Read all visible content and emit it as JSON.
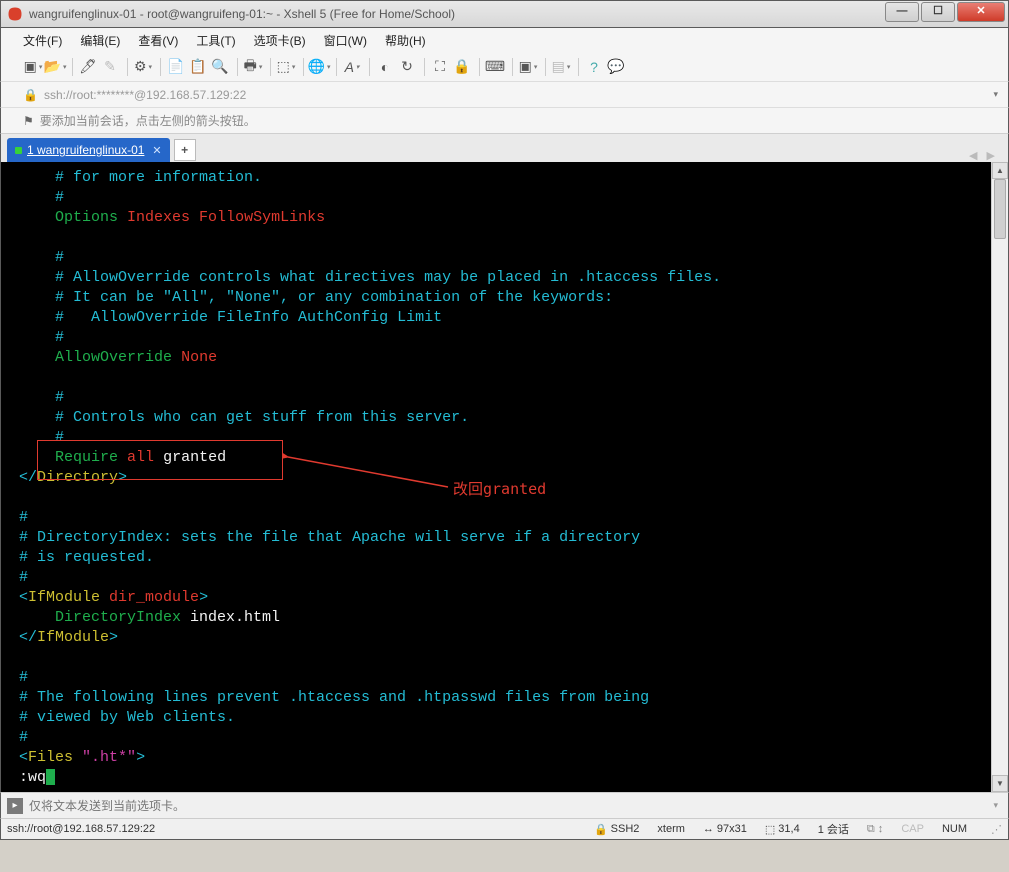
{
  "title": "wangruifenglinux-01 - root@wangruifeng-01:~ - Xshell 5 (Free for Home/School)",
  "menu": {
    "file": "文件(F)",
    "edit": "编辑(E)",
    "view": "查看(V)",
    "tools": "工具(T)",
    "tabs": "选项卡(B)",
    "window": "窗口(W)",
    "help": "帮助(H)"
  },
  "address": "ssh://root:********@192.168.57.129:22",
  "hint": "要添加当前会话，点击左侧的箭头按钮。",
  "tab_name": "1 wangruifenglinux-01",
  "annotation_label": "改回granted",
  "terminal_lines": [
    {
      "indent": 4,
      "parts": [
        {
          "c": "cyan",
          "t": "# for more information."
        }
      ]
    },
    {
      "indent": 4,
      "parts": [
        {
          "c": "cyan",
          "t": "#"
        }
      ]
    },
    {
      "indent": 4,
      "parts": [
        {
          "c": "grn",
          "t": "Options"
        },
        {
          "c": "wht",
          "t": " "
        },
        {
          "c": "red",
          "t": "Indexes FollowSymLinks"
        }
      ]
    },
    {
      "indent": 4,
      "parts": []
    },
    {
      "indent": 4,
      "parts": [
        {
          "c": "cyan",
          "t": "#"
        }
      ]
    },
    {
      "indent": 4,
      "parts": [
        {
          "c": "cyan",
          "t": "# AllowOverride controls what directives may be placed in .htaccess files."
        }
      ]
    },
    {
      "indent": 4,
      "parts": [
        {
          "c": "cyan",
          "t": "# It can be \"All\", \"None\", or any combination of the keywords:"
        }
      ]
    },
    {
      "indent": 4,
      "parts": [
        {
          "c": "cyan",
          "t": "#   AllowOverride FileInfo AuthConfig Limit"
        }
      ]
    },
    {
      "indent": 4,
      "parts": [
        {
          "c": "cyan",
          "t": "#"
        }
      ]
    },
    {
      "indent": 4,
      "parts": [
        {
          "c": "grn",
          "t": "AllowOverride"
        },
        {
          "c": "wht",
          "t": " "
        },
        {
          "c": "red",
          "t": "None"
        }
      ]
    },
    {
      "indent": 4,
      "parts": []
    },
    {
      "indent": 4,
      "parts": [
        {
          "c": "cyan",
          "t": "#"
        }
      ]
    },
    {
      "indent": 4,
      "parts": [
        {
          "c": "cyan",
          "t": "# Controls who can get stuff from this server."
        }
      ]
    },
    {
      "indent": 4,
      "parts": [
        {
          "c": "cyan",
          "t": "#"
        }
      ]
    },
    {
      "indent": 4,
      "parts": [
        {
          "c": "grn",
          "t": "Require"
        },
        {
          "c": "wht",
          "t": " "
        },
        {
          "c": "red",
          "t": "all"
        },
        {
          "c": "wht",
          "t": " granted"
        }
      ]
    },
    {
      "indent": 0,
      "parts": [
        {
          "c": "cyan",
          "t": "</"
        },
        {
          "c": "yel",
          "t": "Directory"
        },
        {
          "c": "cyan",
          "t": ">"
        }
      ]
    },
    {
      "indent": 0,
      "parts": []
    },
    {
      "indent": 0,
      "parts": [
        {
          "c": "cyan",
          "t": "#"
        }
      ]
    },
    {
      "indent": 0,
      "parts": [
        {
          "c": "cyan",
          "t": "# DirectoryIndex: sets the file that Apache will serve if a directory"
        }
      ]
    },
    {
      "indent": 0,
      "parts": [
        {
          "c": "cyan",
          "t": "# is requested."
        }
      ]
    },
    {
      "indent": 0,
      "parts": [
        {
          "c": "cyan",
          "t": "#"
        }
      ]
    },
    {
      "indent": 0,
      "parts": [
        {
          "c": "cyan",
          "t": "<"
        },
        {
          "c": "yel",
          "t": "IfModule"
        },
        {
          "c": "wht",
          "t": " "
        },
        {
          "c": "red",
          "t": "dir_module"
        },
        {
          "c": "cyan",
          "t": ">"
        }
      ]
    },
    {
      "indent": 4,
      "parts": [
        {
          "c": "grn",
          "t": "DirectoryIndex"
        },
        {
          "c": "wht",
          "t": " index.html"
        }
      ]
    },
    {
      "indent": 0,
      "parts": [
        {
          "c": "cyan",
          "t": "</"
        },
        {
          "c": "yel",
          "t": "IfModule"
        },
        {
          "c": "cyan",
          "t": ">"
        }
      ]
    },
    {
      "indent": 0,
      "parts": []
    },
    {
      "indent": 0,
      "parts": [
        {
          "c": "cyan",
          "t": "#"
        }
      ]
    },
    {
      "indent": 0,
      "parts": [
        {
          "c": "cyan",
          "t": "# The following lines prevent .htaccess and .htpasswd files from being"
        }
      ]
    },
    {
      "indent": 0,
      "parts": [
        {
          "c": "cyan",
          "t": "# viewed by Web clients."
        }
      ]
    },
    {
      "indent": 0,
      "parts": [
        {
          "c": "cyan",
          "t": "#"
        }
      ]
    },
    {
      "indent": 0,
      "parts": [
        {
          "c": "cyan",
          "t": "<"
        },
        {
          "c": "yel",
          "t": "Files"
        },
        {
          "c": "wht",
          "t": " "
        },
        {
          "c": "mag",
          "t": "\".ht*\""
        },
        {
          "c": "cyan",
          "t": ">"
        }
      ]
    }
  ],
  "vim_cmd": ":wq",
  "send_placeholder": "仅将文本发送到当前选项卡。",
  "status": {
    "left": "ssh://root@192.168.57.129:22",
    "proto": "SSH2",
    "term": "xterm",
    "size": "97x31",
    "pos": "31,4",
    "sessions": "1 会话",
    "cap": "CAP",
    "num": "NUM"
  }
}
